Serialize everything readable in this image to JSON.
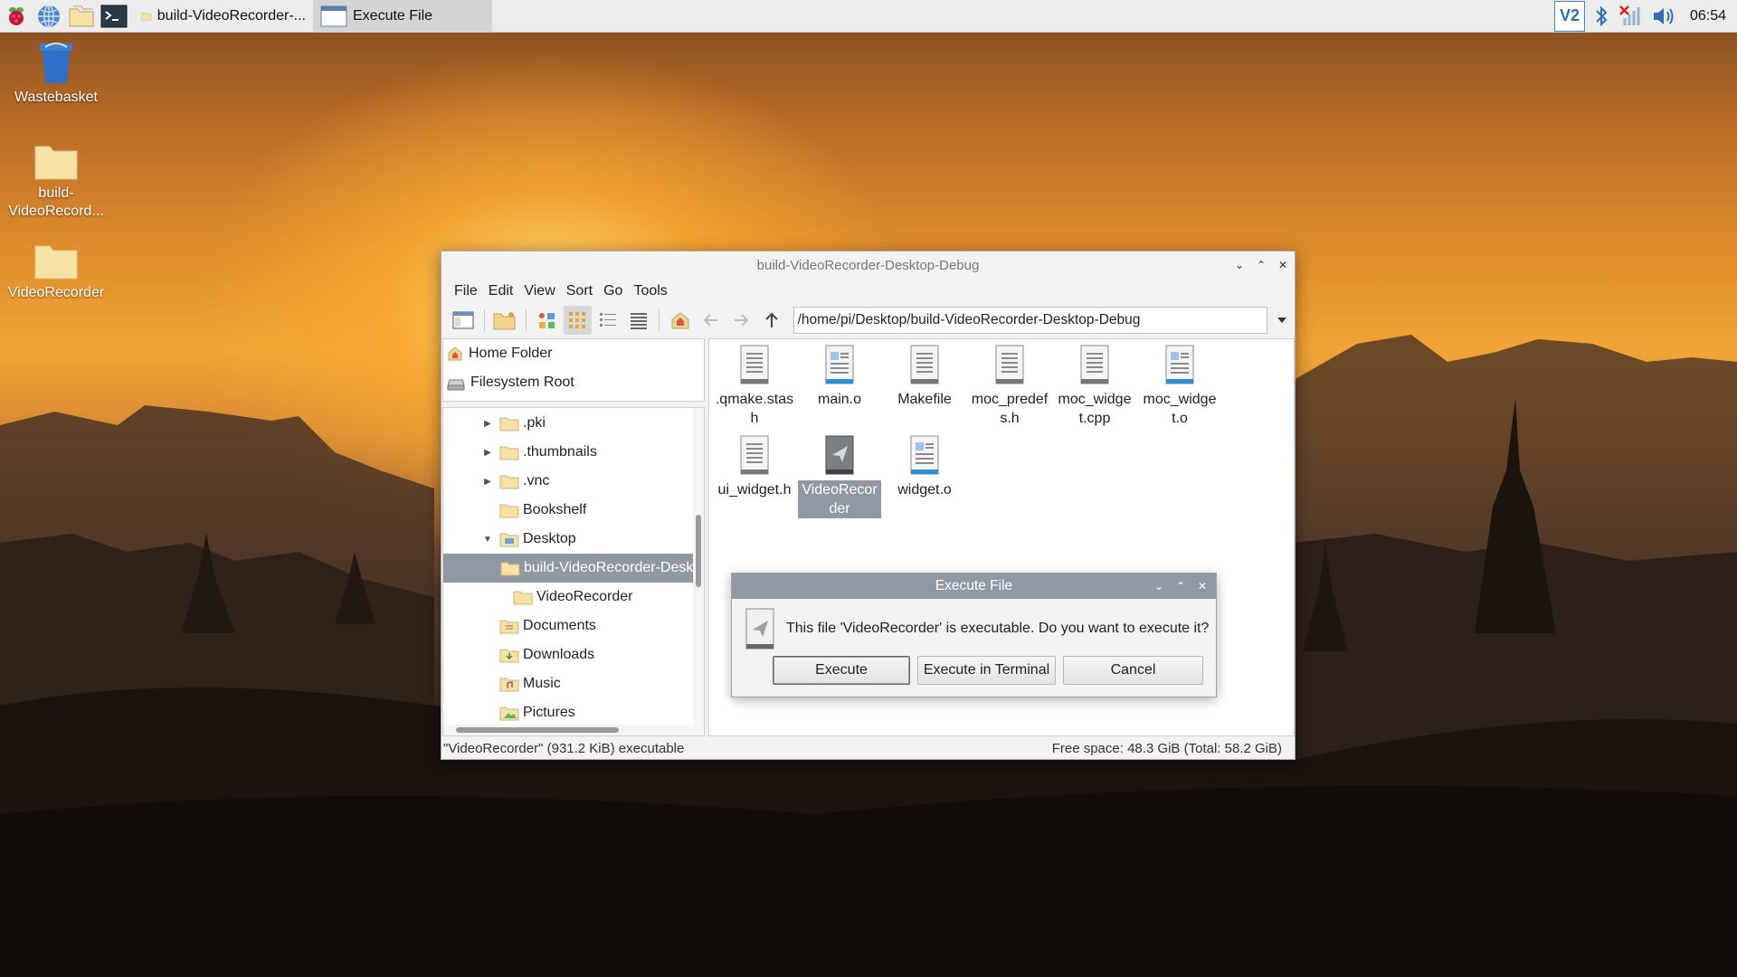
{
  "taskbar": {
    "tasks": [
      {
        "label": "build-VideoRecorder-..."
      },
      {
        "label": "Execute File"
      }
    ],
    "clock": "06:54"
  },
  "desktop": {
    "icons": [
      {
        "label": "Wastebasket"
      },
      {
        "label": "build-VideoRecord..."
      },
      {
        "label": "VideoRecorder"
      }
    ]
  },
  "file_manager": {
    "title": "build-VideoRecorder-Desktop-Debug",
    "menu": [
      "File",
      "Edit",
      "View",
      "Sort",
      "Go",
      "Tools"
    ],
    "path": "/home/pi/Desktop/build-VideoRecorder-Desktop-Debug",
    "places": [
      "Home Folder",
      "Filesystem Root"
    ],
    "tree": [
      {
        "label": ".pki",
        "expander": "▶"
      },
      {
        "label": ".thumbnails",
        "expander": "▶"
      },
      {
        "label": ".vnc",
        "expander": "▶"
      },
      {
        "label": "Bookshelf",
        "expander": ""
      },
      {
        "label": "Desktop",
        "expander": "▼"
      },
      {
        "label": "build-VideoRecorder-Desktop-Debug",
        "expander": "",
        "selected": true
      },
      {
        "label": "VideoRecorder",
        "expander": ""
      },
      {
        "label": "Documents",
        "expander": ""
      },
      {
        "label": "Downloads",
        "expander": ""
      },
      {
        "label": "Music",
        "expander": ""
      },
      {
        "label": "Pictures",
        "expander": ""
      }
    ],
    "files": [
      {
        "name": ".qmake.stash",
        "kind": "text"
      },
      {
        "name": "main.o",
        "kind": "object"
      },
      {
        "name": "Makefile",
        "kind": "text"
      },
      {
        "name": "moc_predefs.h",
        "kind": "text"
      },
      {
        "name": "moc_widget.cpp",
        "kind": "text"
      },
      {
        "name": "moc_widget.o",
        "kind": "object"
      },
      {
        "name": "ui_widget.h",
        "kind": "text"
      },
      {
        "name": "VideoRecorder",
        "kind": "executable",
        "selected": true
      },
      {
        "name": "widget.o",
        "kind": "object"
      }
    ],
    "status_left": "\"VideoRecorder\" (931.2 KiB) executable",
    "status_right": "Free space: 48.3 GiB (Total: 58.2 GiB)"
  },
  "dialog": {
    "title": "Execute File",
    "message": "This file 'VideoRecorder' is executable. Do you want to execute it?",
    "buttons": {
      "execute": "Execute",
      "execute_terminal": "Execute in Terminal",
      "cancel": "Cancel"
    }
  }
}
